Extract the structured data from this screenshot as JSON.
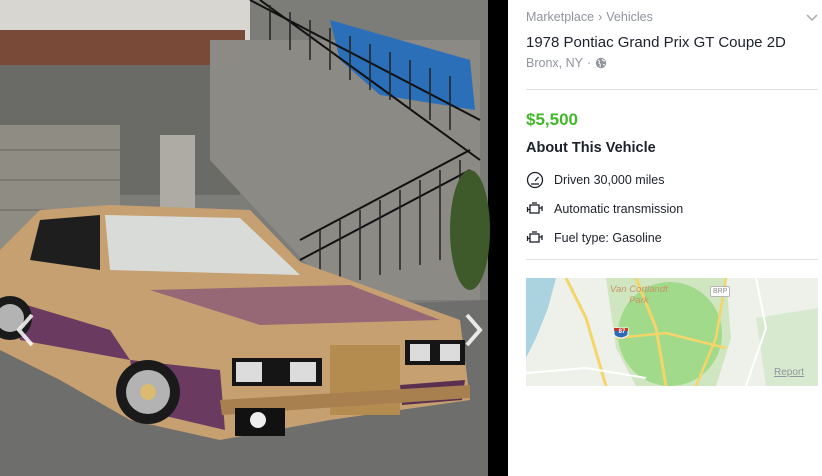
{
  "breadcrumb": {
    "root": "Marketplace",
    "separator": "›",
    "category": "Vehicles"
  },
  "listing": {
    "title": "1978 Pontiac Grand Prix GT Coupe 2D",
    "location": "Bronx, NY",
    "location_separator": "·",
    "price": "$5,500",
    "price_color": "#42b72a"
  },
  "about": {
    "heading": "About This Vehicle",
    "specs": [
      {
        "icon": "speedometer-icon",
        "text": "Driven 30,000 miles"
      },
      {
        "icon": "engine-icon",
        "text": "Automatic transmission"
      },
      {
        "icon": "engine-icon",
        "text": "Fuel type: Gasoline"
      }
    ]
  },
  "map": {
    "park_label_line1": "Van Cortlandt",
    "park_label_line2": "Park",
    "road_badge": "BRP",
    "highway_shield": "87",
    "report_link": "Report"
  }
}
